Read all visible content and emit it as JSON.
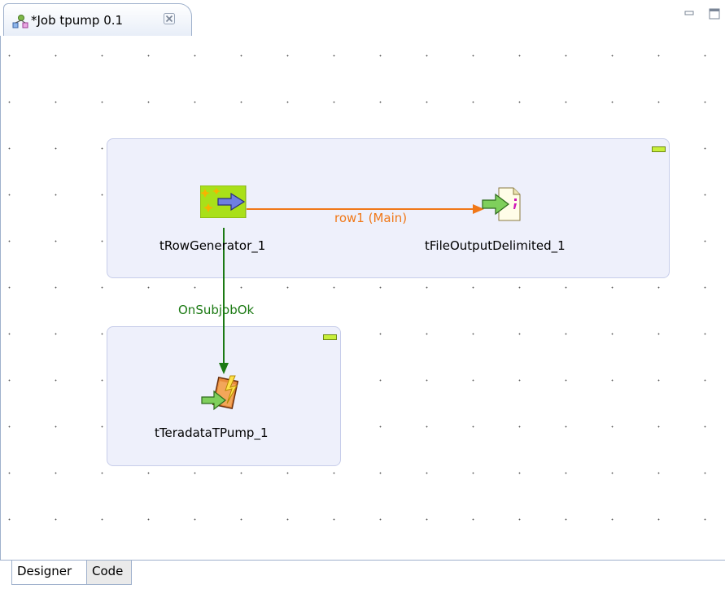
{
  "tab": {
    "title": "*Job tpump 0.1",
    "icon": "job-icon",
    "close_icon": "close-icon"
  },
  "window_controls": [
    "minimize-icon",
    "maximize-icon"
  ],
  "subjobs": [
    {
      "name": "subjob-1",
      "color": "#eef0fb"
    },
    {
      "name": "subjob-2",
      "color": "#eef0fb"
    }
  ],
  "components": {
    "row_generator": {
      "label": "tRowGenerator_1",
      "icon": "row-generator-icon"
    },
    "file_output": {
      "label": "tFileOutputDelimited_1",
      "icon": "file-output-icon"
    },
    "teradata": {
      "label": "tTeradataTPump_1",
      "icon": "teradata-tpump-icon"
    }
  },
  "links": {
    "main": {
      "label": "row1 (Main)",
      "color": "#f07818"
    },
    "trigger": {
      "label": "OnSubjobOk",
      "color": "#1c7a14"
    }
  },
  "bottom_tabs": [
    "Designer",
    "Code"
  ]
}
